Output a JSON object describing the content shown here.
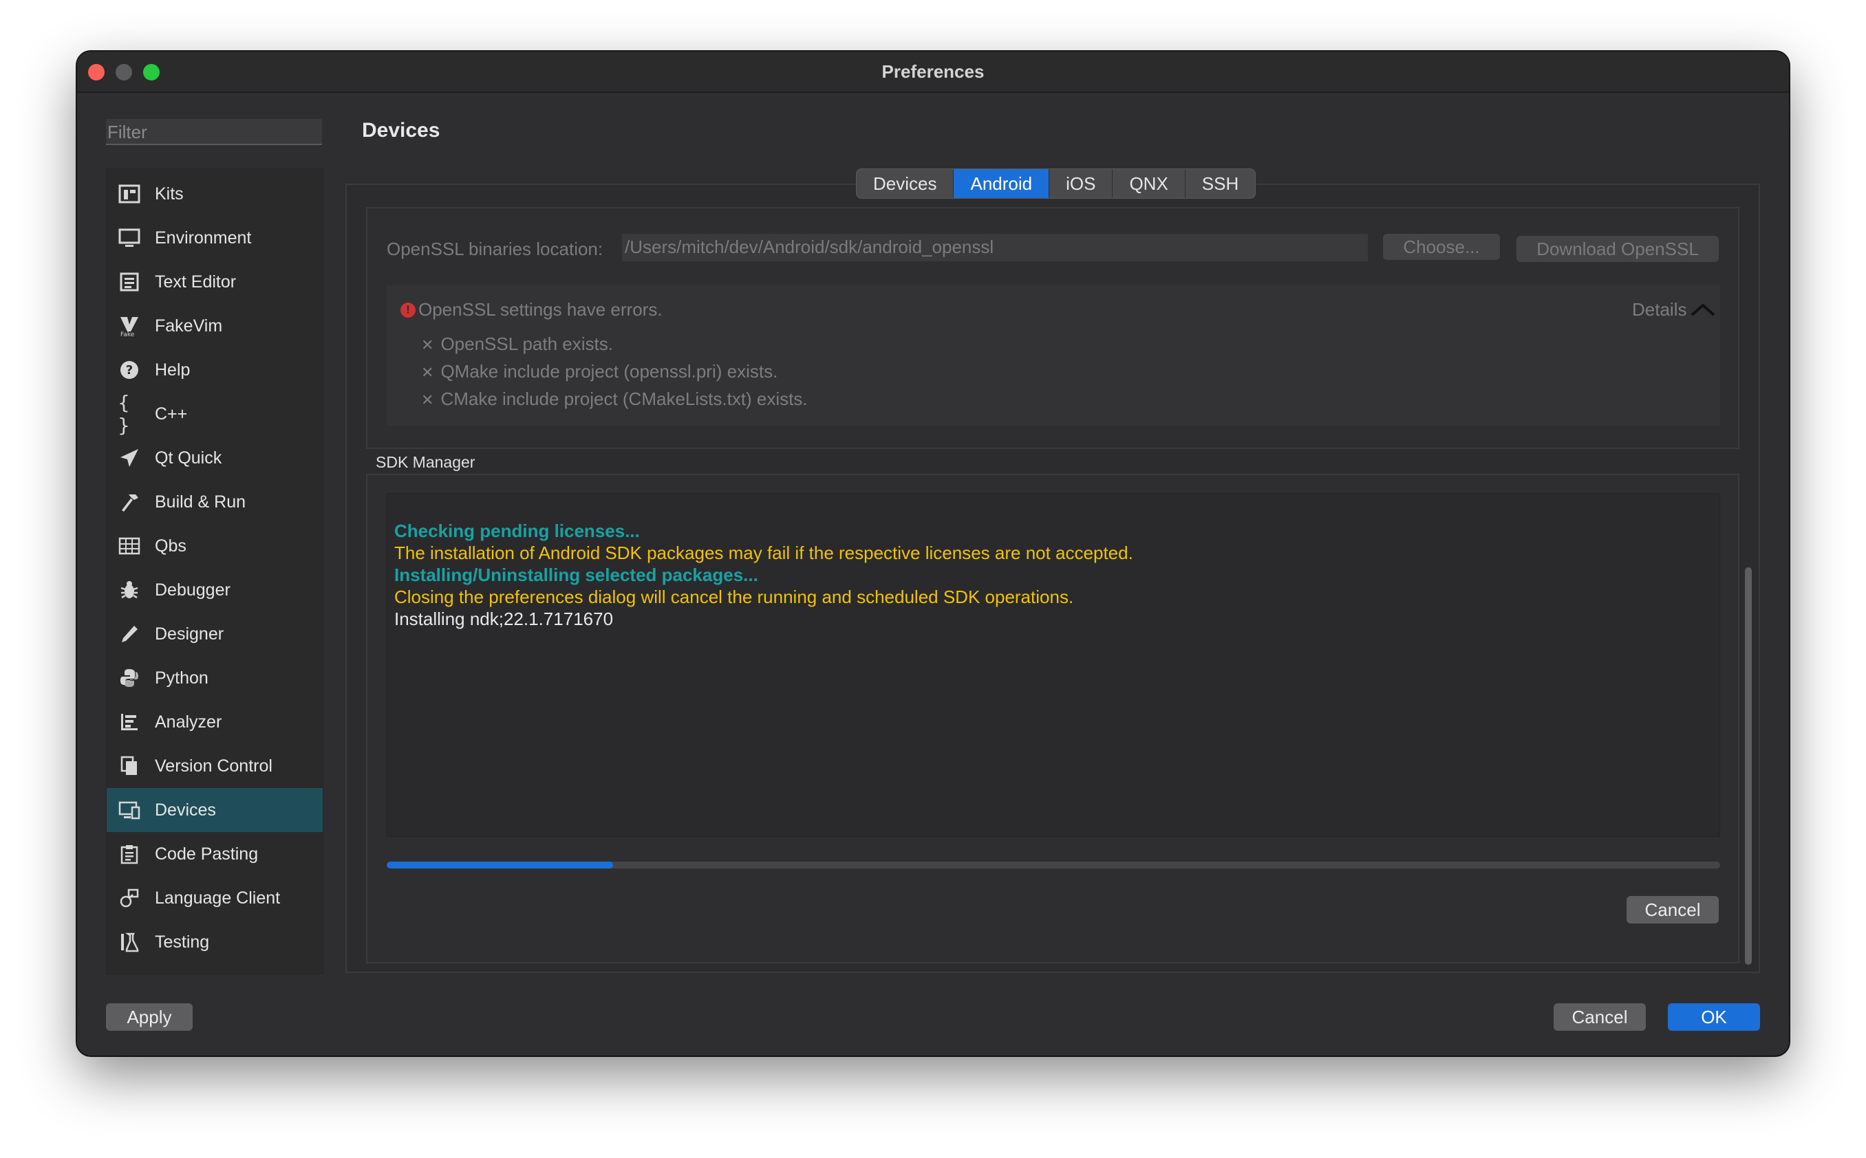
{
  "window": {
    "title": "Preferences"
  },
  "filter": {
    "placeholder": "Filter"
  },
  "sidebar": {
    "items": [
      {
        "label": "Kits",
        "icon": "kits-icon"
      },
      {
        "label": "Environment",
        "icon": "monitor-icon"
      },
      {
        "label": "Text Editor",
        "icon": "text-editor-icon"
      },
      {
        "label": "FakeVim",
        "icon": "fakevim-icon"
      },
      {
        "label": "Help",
        "icon": "help-icon"
      },
      {
        "label": "C++",
        "icon": "braces-icon"
      },
      {
        "label": "Qt Quick",
        "icon": "paper-plane-icon"
      },
      {
        "label": "Build & Run",
        "icon": "hammer-icon"
      },
      {
        "label": "Qbs",
        "icon": "qbs-grid-icon"
      },
      {
        "label": "Debugger",
        "icon": "bug-icon"
      },
      {
        "label": "Designer",
        "icon": "pencil-icon"
      },
      {
        "label": "Python",
        "icon": "python-icon"
      },
      {
        "label": "Analyzer",
        "icon": "analyzer-icon"
      },
      {
        "label": "Version Control",
        "icon": "version-control-icon"
      },
      {
        "label": "Devices",
        "icon": "devices-icon",
        "selected": true
      },
      {
        "label": "Code Pasting",
        "icon": "clipboard-icon"
      },
      {
        "label": "Language Client",
        "icon": "language-client-icon"
      },
      {
        "label": "Testing",
        "icon": "flask-icon"
      }
    ]
  },
  "page": {
    "title": "Devices"
  },
  "tabs": [
    {
      "label": "Devices"
    },
    {
      "label": "Android",
      "active": true
    },
    {
      "label": "iOS"
    },
    {
      "label": "QNX"
    },
    {
      "label": "SSH"
    }
  ],
  "openssl": {
    "label": "OpenSSL binaries location:",
    "path": "/Users/mitch/dev/Android/sdk/android_openssl",
    "choose_label": "Choose...",
    "download_label": "Download OpenSSL",
    "error_title": "OpenSSL settings have errors.",
    "details_label": "Details",
    "errors": [
      "OpenSSL path exists.",
      "QMake include project (openssl.pri) exists.",
      "CMake include project (CMakeLists.txt) exists."
    ]
  },
  "sdk": {
    "title": "SDK Manager",
    "log": [
      {
        "text": "Checking pending licenses...",
        "style": "teal"
      },
      {
        "text": "The installation of Android SDK packages may fail if the respective licenses are not accepted.",
        "style": "yellow"
      },
      {
        "text": "Installing/Uninstalling selected packages...",
        "style": "teal"
      },
      {
        "text": "Closing the preferences dialog will cancel the running and scheduled SDK operations.",
        "style": "yellow"
      },
      {
        "text": "Installing ndk;22.1.7171670",
        "style": "white"
      }
    ],
    "progress_percent": 17,
    "cancel_label": "Cancel"
  },
  "footer": {
    "apply_label": "Apply",
    "cancel_label": "Cancel",
    "ok_label": "OK"
  },
  "colors": {
    "accent": "#1b6fd8",
    "selected_sidebar": "#1f4e5a",
    "log_teal": "#17a2a4",
    "log_yellow": "#f2c200"
  }
}
